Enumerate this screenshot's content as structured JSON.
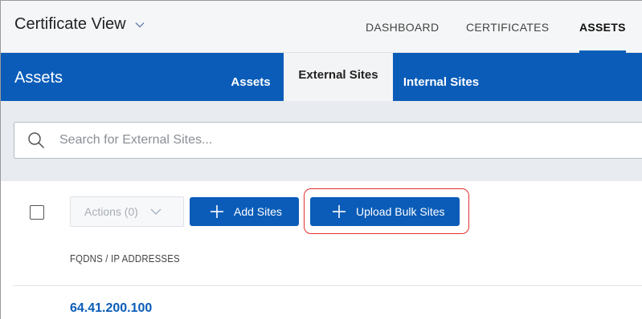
{
  "header": {
    "app_title": "Certificate View",
    "nav": [
      {
        "label": "DASHBOARD"
      },
      {
        "label": "CERTIFICATES"
      },
      {
        "label": "ASSETS",
        "active": true
      }
    ]
  },
  "section": {
    "title": "Assets",
    "tabs": [
      {
        "label": "Assets"
      },
      {
        "label": "External Sites",
        "active": true
      },
      {
        "label": "Internal Sites"
      }
    ]
  },
  "search": {
    "placeholder": "Search for External Sites...",
    "value": ""
  },
  "toolbar": {
    "actions_label": "Actions (0)",
    "add_label": "Add Sites",
    "bulk_label": "Upload Bulk Sites"
  },
  "table": {
    "columns": [
      "FQDNS / IP ADDRESSES"
    ],
    "rows": [
      {
        "address": "64.41.200.100"
      }
    ]
  },
  "colors": {
    "brand": "#0a5cb8",
    "highlight": "#e0312f",
    "search_bg": "#e8ebef"
  },
  "icons": {
    "app_switch": "chevron-down-icon",
    "search": "search-icon",
    "actions": "chevron-down-icon",
    "add": "plus-icon",
    "bulk": "plus-icon"
  }
}
